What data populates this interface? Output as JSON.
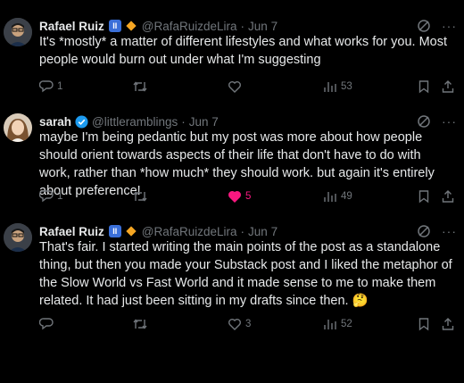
{
  "tweets": [
    {
      "name": "Rafael Ruiz",
      "handle": "@RafaRuizdeLira",
      "separator": "·",
      "date": "Jun 7",
      "text": "It's *mostly* a matter of different lifestyles and what works for you. Most people would burn out under what I'm suggesting",
      "replies": "1",
      "retweets": "",
      "likes": "",
      "views": "53",
      "liked": false
    },
    {
      "name": "sarah",
      "handle": "@littleramblings",
      "separator": "·",
      "date": "Jun 7",
      "text": "maybe I'm being pedantic but my post was more about how people should orient towards aspects of their life that don't have to do with work, rather than *how much* they should work. but again it's entirely about preference!",
      "replies": "1",
      "retweets": "",
      "likes": "5",
      "views": "49",
      "liked": true
    },
    {
      "name": "Rafael Ruiz",
      "handle": "@RafaRuizdeLira",
      "separator": "·",
      "date": "Jun 7",
      "text": "That's fair. I started writing the main points of the post as a standalone thing, but then you made your Substack post and I liked the metaphor of the Slow World vs Fast World and it made sense to me to make them related. It had just been sitting in my drafts since then.",
      "emoji": "🤔",
      "replies": "",
      "retweets": "",
      "likes": "3",
      "views": "52",
      "liked": false
    }
  ],
  "badge_ii": "II",
  "more_label": "···",
  "colors": {
    "background": "#000000",
    "text": "#e7e9ea",
    "muted": "#71767b",
    "like": "#f91880",
    "verified": "#1d9bf0",
    "diamond": "#f5a623"
  },
  "icons": [
    "grok-icon",
    "more-icon",
    "reply-icon",
    "retweet-icon",
    "like-icon",
    "views-icon",
    "bookmark-icon",
    "share-icon"
  ]
}
